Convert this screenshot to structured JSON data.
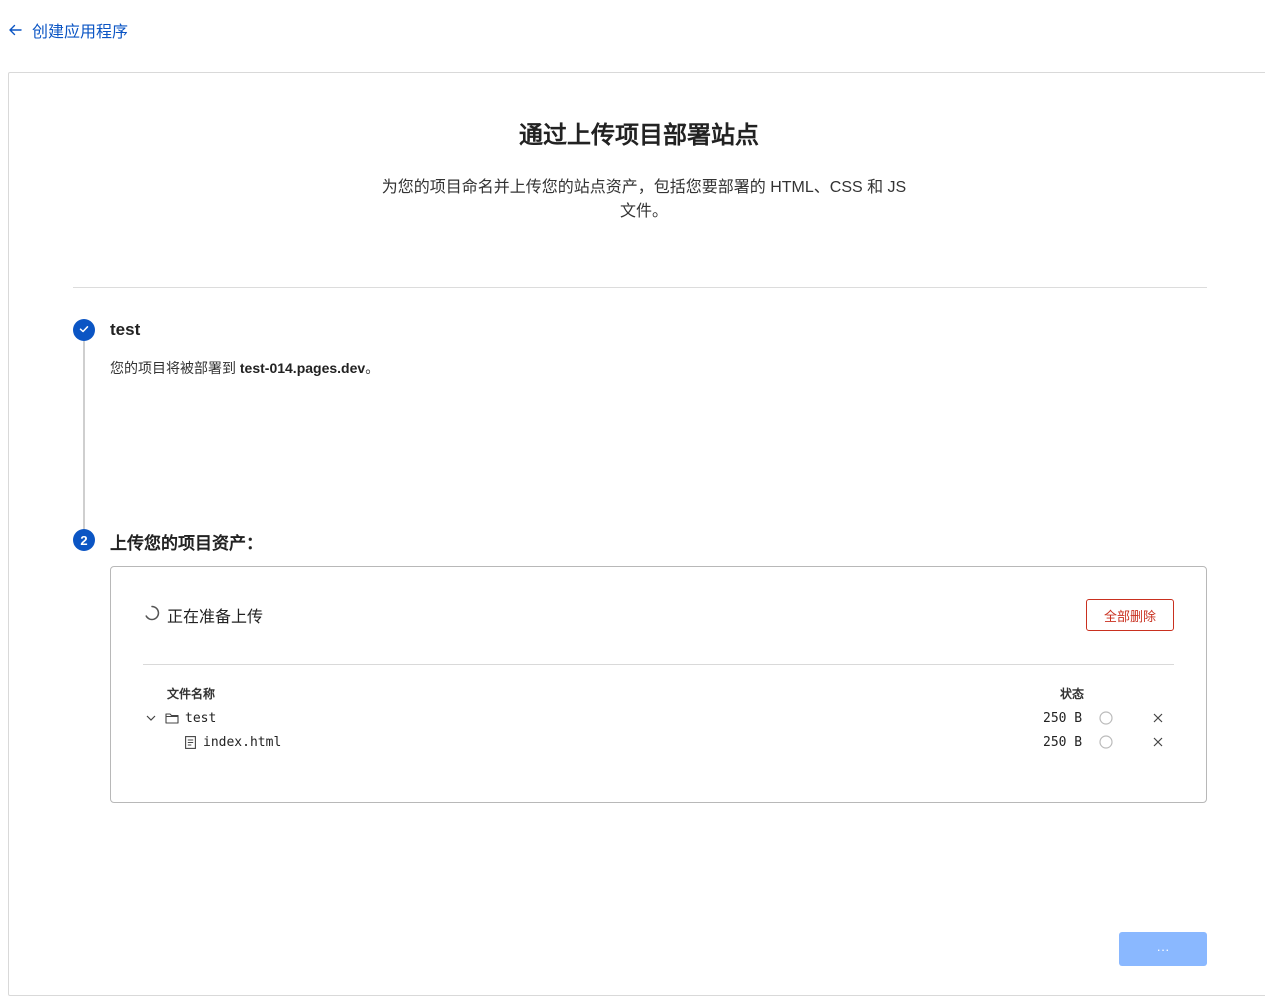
{
  "nav": {
    "back_label": "创建应用程序"
  },
  "page": {
    "title": "通过上传项目部署站点",
    "description": "为您的项目命名并上传您的站点资产，包括您要部署的 HTML、CSS 和 JS 文件。"
  },
  "step1": {
    "title": "test",
    "desc_prefix": "您的项目将被部署到 ",
    "domain": "test-014.pages.dev",
    "desc_suffix": "。"
  },
  "step2": {
    "number": "2",
    "title": "上传您的项目资产："
  },
  "upload": {
    "status_text": "正在准备上传",
    "delete_all_label": "全部删除",
    "columns": {
      "name": "文件名称",
      "status": "状态"
    },
    "files": [
      {
        "name": "test",
        "type": "folder",
        "size": "250 B"
      },
      {
        "name": "index.html",
        "type": "file",
        "size": "250 B"
      }
    ]
  },
  "footer": {
    "next_label": "···"
  },
  "colors": {
    "accent": "#0b55c4",
    "danger": "#c9301f",
    "disabled_button": "#8ab8ff"
  }
}
